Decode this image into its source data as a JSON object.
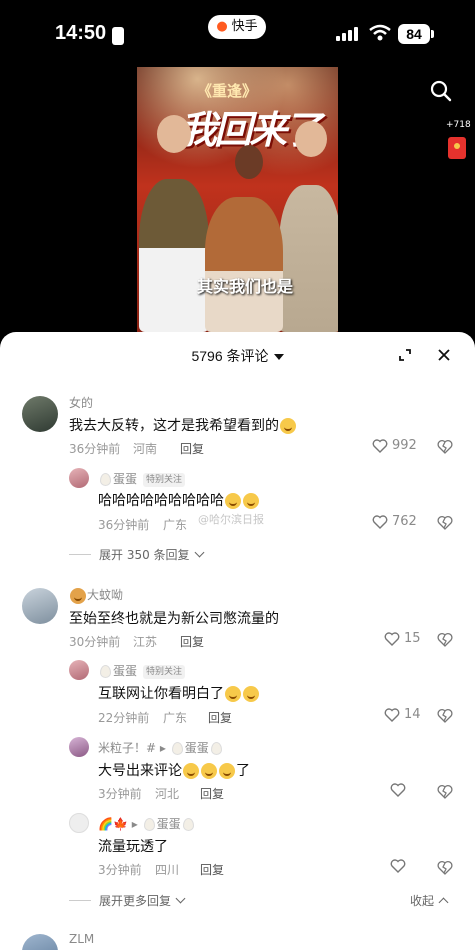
{
  "status_bar": {
    "time": "14:50",
    "app_pill": "快手",
    "battery": "84"
  },
  "video": {
    "show_title": "《重逢》",
    "big_title": "我回来了",
    "subtitle": "其实我们也是",
    "coin_count": "+718"
  },
  "comments_sheet": {
    "count_label": "5796 条评论"
  },
  "watermark": "@哈尔滨日报",
  "comments": [
    {
      "name": "女的",
      "text": "我去大反转，这才是我希望看到的",
      "time": "36分钟前",
      "location": "河南",
      "reply": "回复",
      "likes": "992"
    },
    {
      "name": "蛋蛋",
      "tag": "特别关注",
      "text": "哈哈哈哈哈哈哈哈哈",
      "time": "36分钟前",
      "location": "广东",
      "reply": "回复",
      "likes": "762"
    },
    {
      "expand": "展开 350 条回复"
    },
    {
      "name": "大蚊呦",
      "text": "至始至终也就是为新公司憋流量的",
      "time": "30分钟前",
      "location": "江苏",
      "reply": "回复",
      "likes": "15"
    },
    {
      "name": "蛋蛋",
      "tag": "特别关注",
      "text": "互联网让你看明白了",
      "time": "22分钟前",
      "location": "广东",
      "reply": "回复",
      "likes": "14"
    },
    {
      "name": "米粒子！#",
      "reply_to": "蛋蛋",
      "text": "大号出来评论",
      "time": "3分钟前",
      "location": "河北",
      "reply": "回复"
    },
    {
      "reply_to": "蛋蛋",
      "text": "流量玩透了",
      "time": "3分钟前",
      "location": "四川",
      "reply": "回复"
    },
    {
      "expand": "展开更多回复",
      "collapse": "收起"
    },
    {
      "name": "ZLM"
    }
  ],
  "colors": {
    "accent_orange": "#ff5a1f",
    "red": "#e5322d",
    "text": "#111111",
    "muted": "#999999"
  }
}
